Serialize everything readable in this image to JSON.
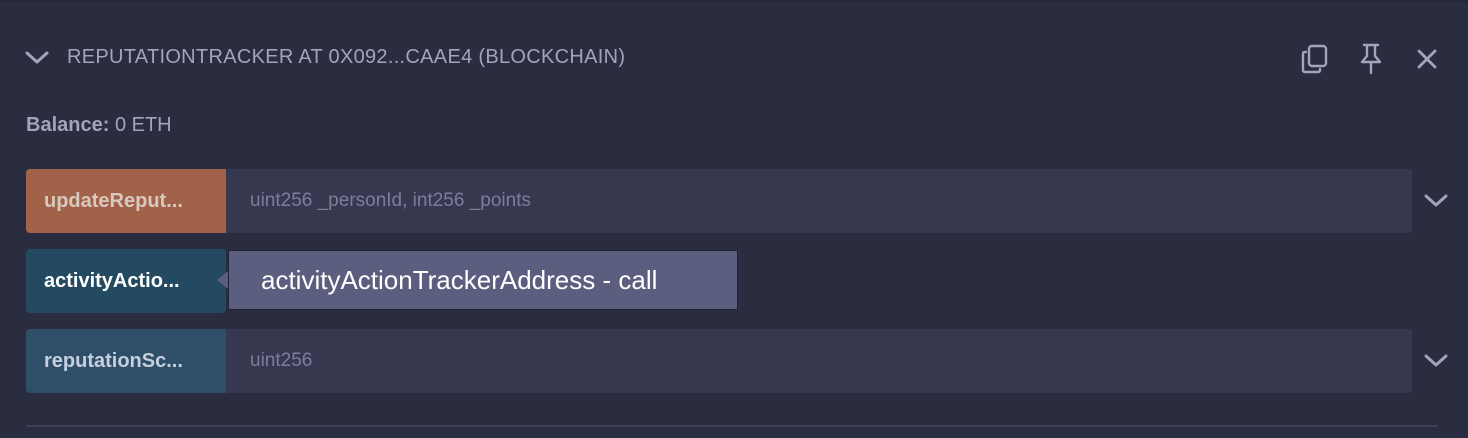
{
  "header": {
    "title": "REPUTATIONTRACKER AT 0X092...CAAE4 (BLOCKCHAIN)",
    "icons": [
      "chevron-down-icon",
      "copy-icon",
      "pin-icon",
      "close-icon"
    ]
  },
  "balance": {
    "label": "Balance:",
    "value": "0 ETH"
  },
  "functions": [
    {
      "label": "updateReput...",
      "kind": "transact",
      "color": "#a26149",
      "placeholder": "uint256 _personId, int256 _points"
    },
    {
      "label": "activityActio...",
      "kind": "call",
      "color": "#234a60"
    },
    {
      "label": "reputationSc...",
      "kind": "call",
      "color": "#2f4e67",
      "placeholder": "uint256"
    }
  ],
  "tooltip": {
    "text": "activityActionTrackerAddress - call"
  }
}
